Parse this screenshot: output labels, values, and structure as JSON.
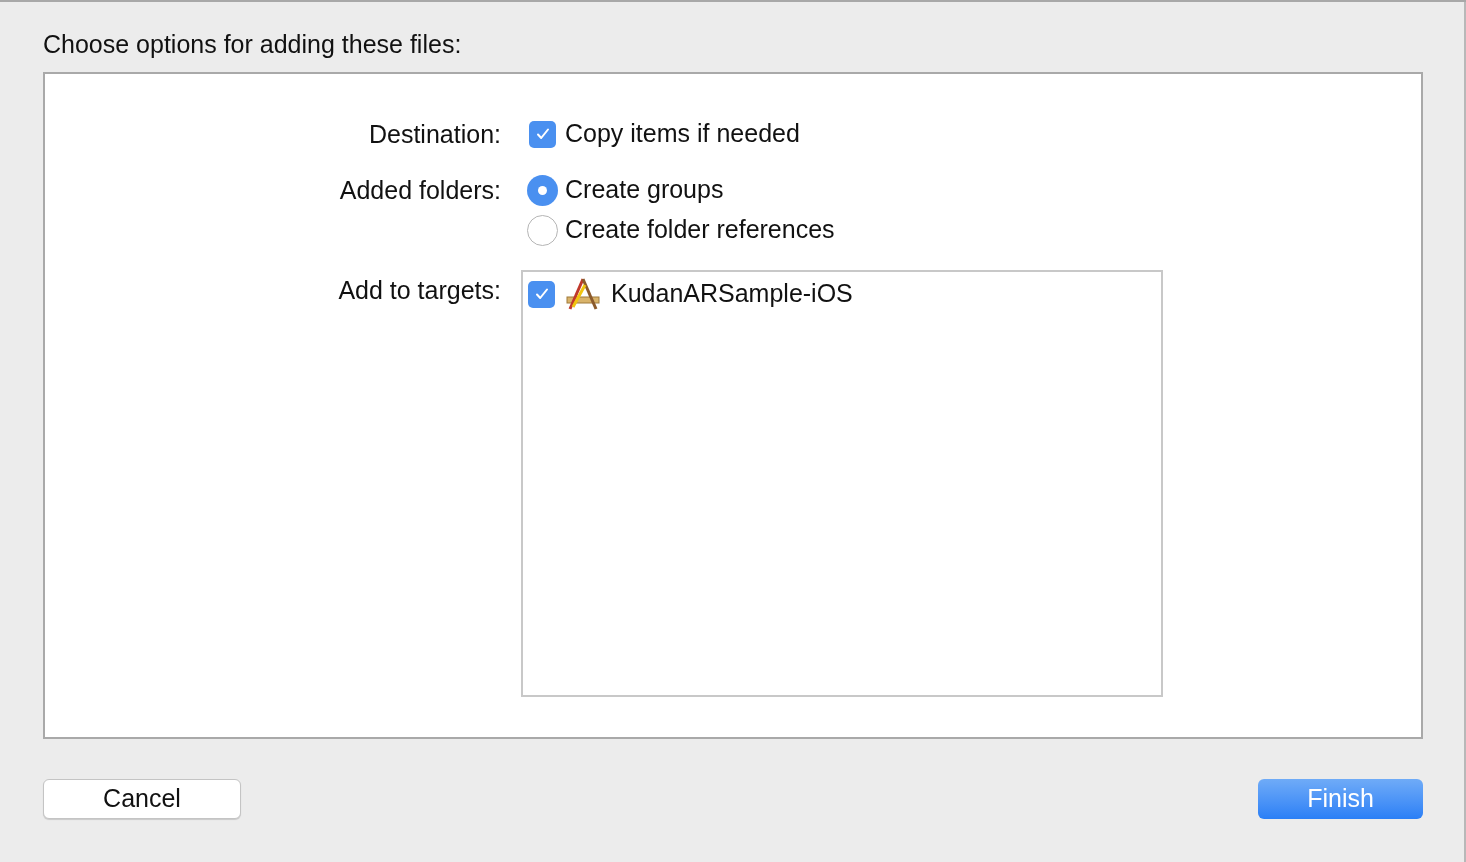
{
  "heading": "Choose options for adding these files:",
  "destination": {
    "label": "Destination:",
    "option": {
      "label": "Copy items if needed",
      "checked": true
    }
  },
  "added_folders": {
    "label": "Added folders:",
    "options": [
      {
        "label": "Create groups",
        "selected": true
      },
      {
        "label": "Create folder references",
        "selected": false
      }
    ]
  },
  "targets": {
    "label": "Add to targets:",
    "items": [
      {
        "label": "KudanARSample-iOS",
        "checked": true
      }
    ]
  },
  "buttons": {
    "cancel": "Cancel",
    "finish": "Finish"
  }
}
